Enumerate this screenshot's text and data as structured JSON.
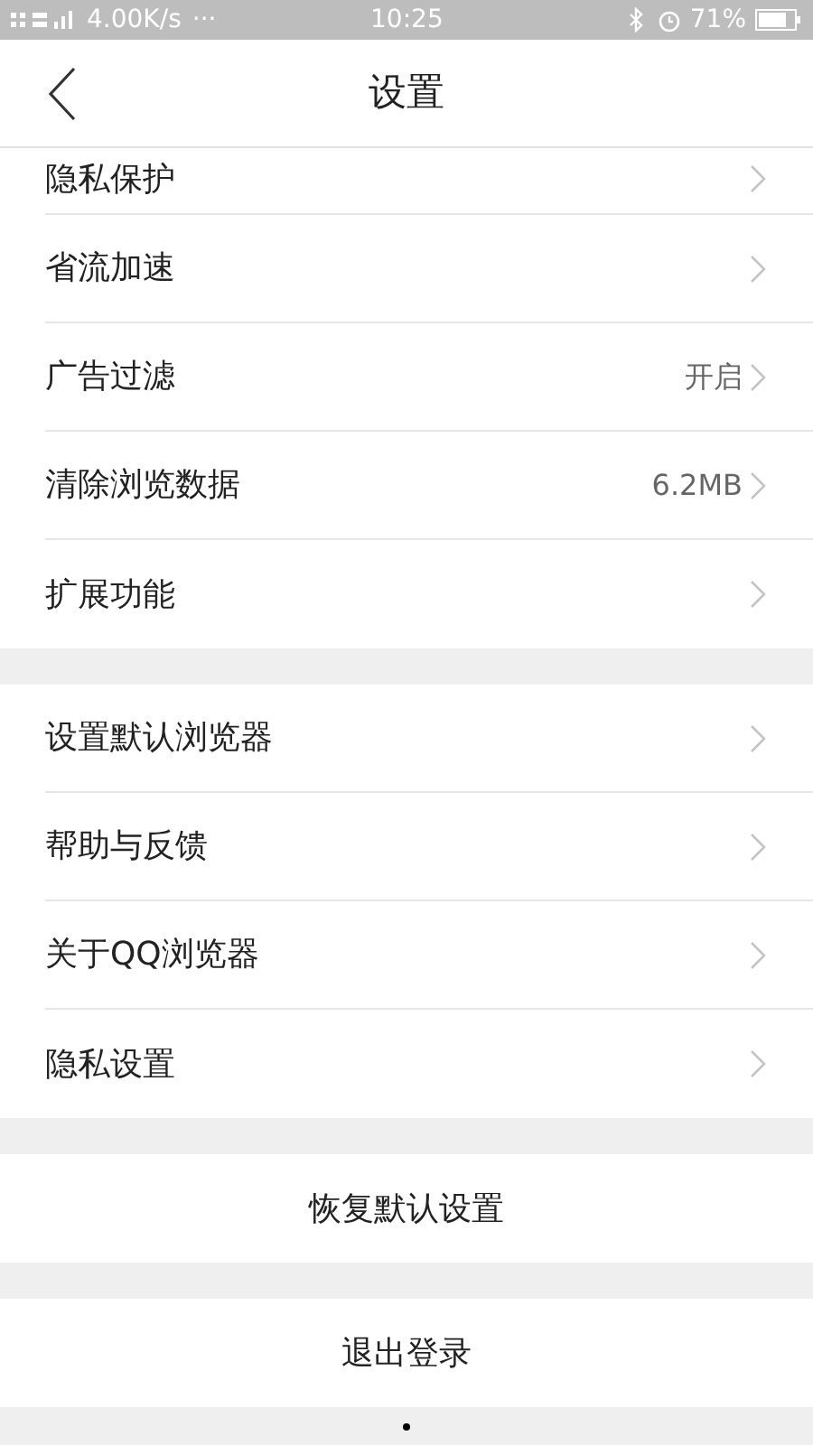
{
  "status_bar": {
    "network": "4.00K/s",
    "more": "···",
    "time": "10:25",
    "battery": "71%"
  },
  "header": {
    "title": "设置"
  },
  "groups": [
    {
      "items": [
        {
          "label": "隐私保护"
        },
        {
          "label": "省流加速"
        },
        {
          "label": "广告过滤",
          "value": "开启"
        },
        {
          "label": "清除浏览数据",
          "value": "6.2MB"
        },
        {
          "label": "扩展功能"
        }
      ]
    },
    {
      "items": [
        {
          "label": "设置默认浏览器"
        },
        {
          "label": "帮助与反馈"
        },
        {
          "label": "关于QQ浏览器"
        },
        {
          "label": "隐私设置"
        }
      ]
    }
  ],
  "buttons": [
    "恢复默认设置",
    "退出登录"
  ]
}
